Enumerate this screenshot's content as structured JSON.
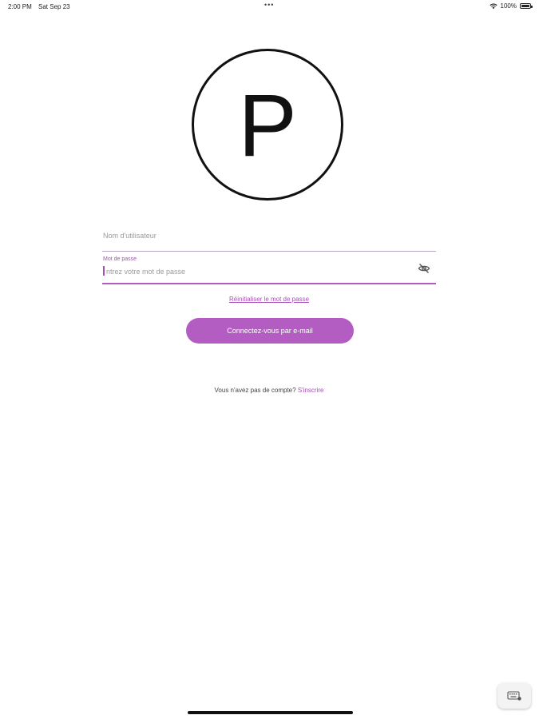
{
  "status_bar": {
    "time": "2:00 PM",
    "date": "Sat Sep 23",
    "battery": "100%",
    "icons": [
      "wifi-icon",
      "battery-icon"
    ],
    "multitasking_dots": "•••"
  },
  "logo": {
    "letter": "P"
  },
  "login_form": {
    "username": {
      "placeholder": "Nom d'utilisateur",
      "value": ""
    },
    "password": {
      "label": "Mot de passe",
      "placeholder": "ntrez votre mot de passe",
      "value": "",
      "visibility_icon": "eye-off-icon"
    },
    "reset_password_link": "Réinitialiser le mot de passe",
    "submit_button": "Connectez-vous par e-mail",
    "signup_prompt": "Vous n'avez pas de compte?",
    "signup_link": "S'inscrire"
  },
  "floating_button": {
    "icon": "keyboard-icon"
  },
  "colors": {
    "accent": "#b35dc2",
    "text": "#222222",
    "placeholder": "#9a9a9a",
    "background": "#ffffff"
  }
}
